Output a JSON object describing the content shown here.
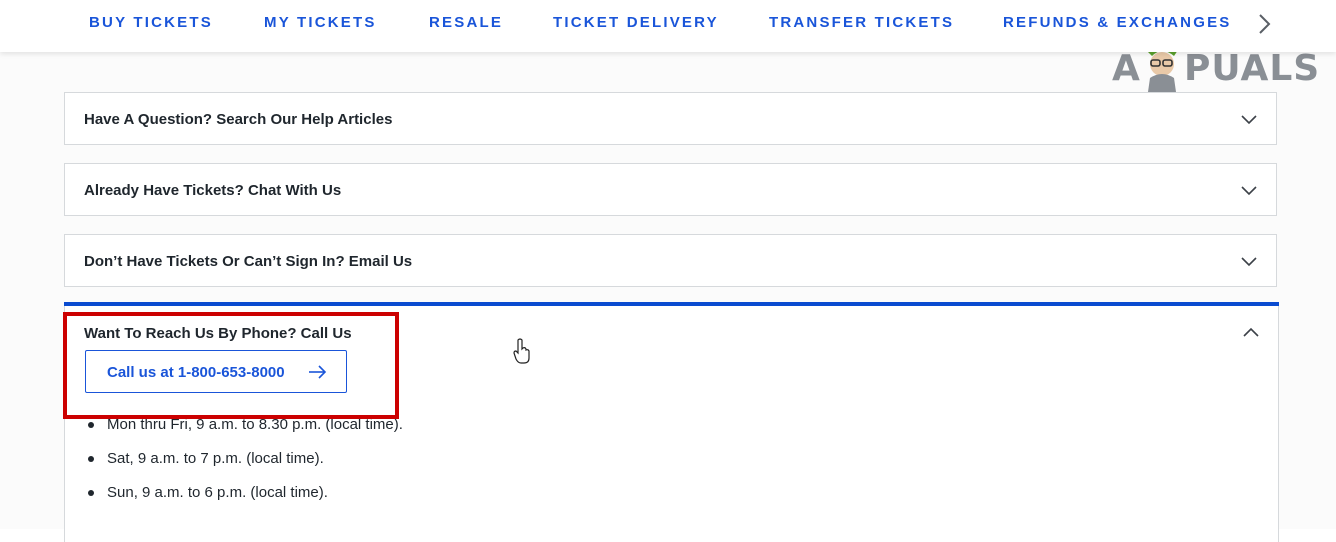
{
  "nav": {
    "items": [
      {
        "label": "BUY TICKETS"
      },
      {
        "label": "MY TICKETS"
      },
      {
        "label": "RESALE"
      },
      {
        "label": "TICKET DELIVERY"
      },
      {
        "label": "TRANSFER TICKETS"
      },
      {
        "label": "REFUNDS & EXCHANGES"
      }
    ],
    "next_icon": "chevron-right-icon"
  },
  "watermark": {
    "text_left": "A",
    "text_right": "PUALS",
    "mascot": "appuals-mascot-logo"
  },
  "accordion": {
    "panels": [
      {
        "title": "Have A Question? Search Our Help Articles",
        "state": "collapsed"
      },
      {
        "title": "Already Have Tickets? Chat With Us",
        "state": "collapsed"
      },
      {
        "title": "Don’t Have Tickets Or Can’t Sign In? Email Us",
        "state": "collapsed"
      }
    ],
    "open_panel": {
      "title": "Want To Reach Us By Phone? Call Us",
      "state": "expanded",
      "call_button": "Call us at 1-800-653-8000",
      "call_icon": "arrow-right-icon",
      "hours": [
        "Mon thru Fri, 9 a.m. to 8.30 p.m. (local time).",
        "Sat, 9 a.m. to 7 p.m. (local time).",
        "Sun, 9 a.m. to 6 p.m. (local time)."
      ]
    }
  },
  "colors": {
    "accent_blue": "#1a55d9",
    "open_bar": "#0a4bd0",
    "highlight_red": "#cc0000"
  }
}
